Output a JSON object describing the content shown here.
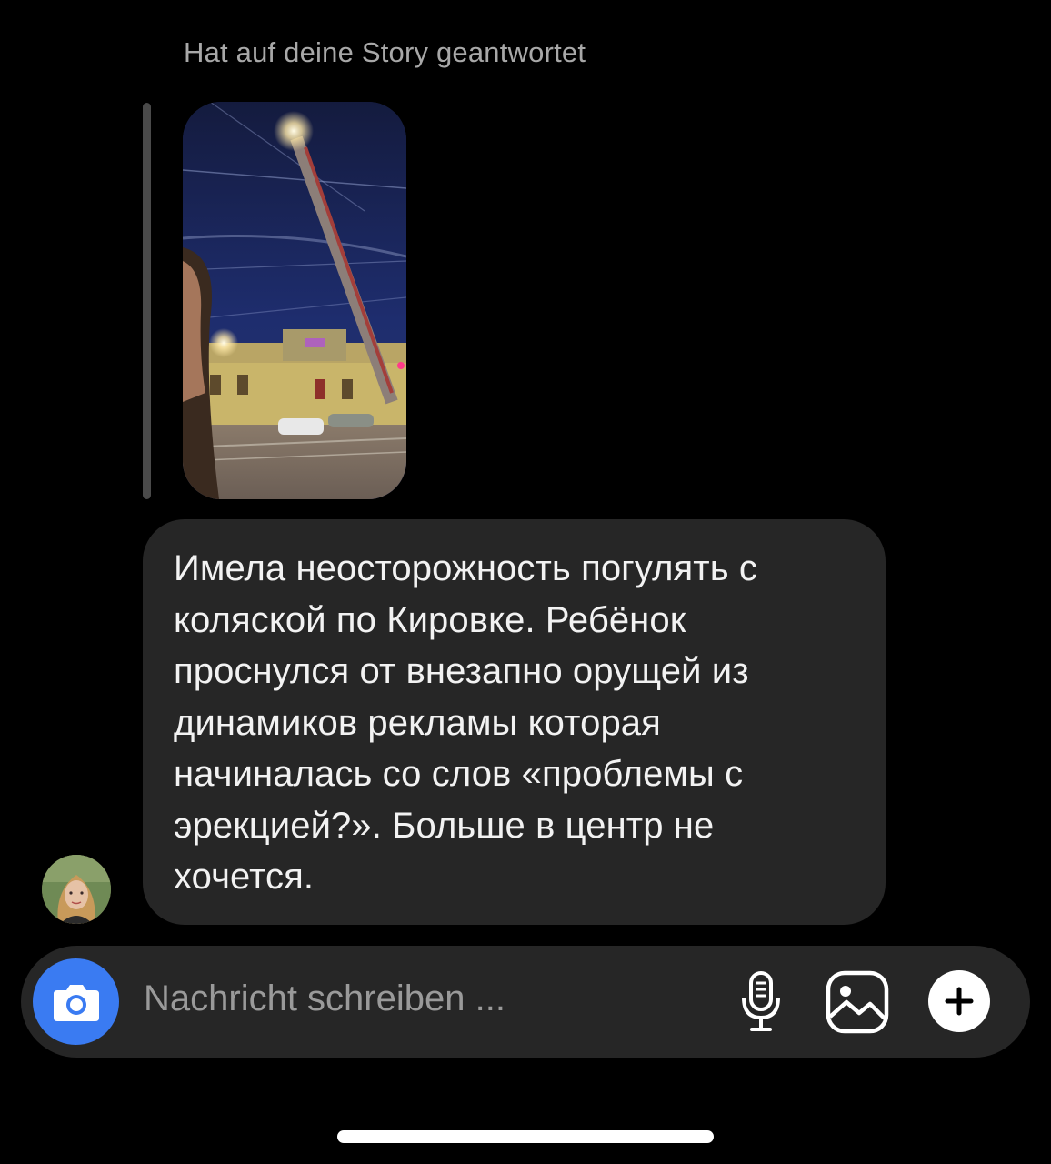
{
  "reply_context": {
    "header": "Hat auf deine Story geantwortet",
    "story_image": "night-street-selfie-thumbnail"
  },
  "message": {
    "text": "Имела неосторожность погулять с коляской по Кировке. Ребёнок проснулся от внезапно орущей из динамиков рекламы которая начиналась со слов «проблемы с эрекцией?». Больше в центр не хочется.",
    "bubble_color": "#262626"
  },
  "sender": {
    "avatar": "profile-photo"
  },
  "composer": {
    "placeholder": "Nachricht schreiben ...",
    "camera_icon": "camera-icon",
    "mic_icon": "microphone-icon",
    "gallery_icon": "image-gallery-icon",
    "plus_icon": "plus-icon",
    "accent_color": "#3a7bf2"
  }
}
